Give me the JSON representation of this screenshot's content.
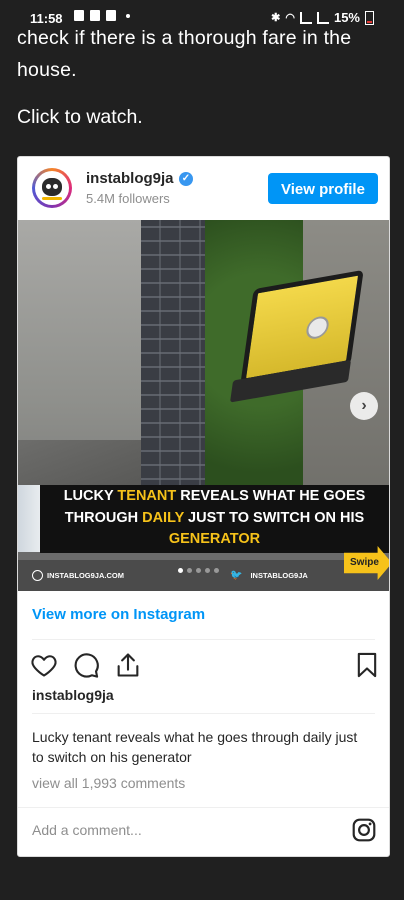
{
  "status_bar": {
    "time": "11:58",
    "battery": "15%"
  },
  "article": {
    "text": "check if there is a thorough fare in the house.",
    "click_to_watch": "Click to watch."
  },
  "embed": {
    "username": "instablog9ja",
    "verified_mark": "✓",
    "followers": "5.4M followers",
    "view_profile_label": "View profile",
    "media": {
      "caption_line1_a": "LUCKY ",
      "caption_line1_b": "TENANT",
      "caption_line1_c": " REVEALS WHAT HE GOES",
      "caption_line2_a": "THROUGH ",
      "caption_line2_b": "DAILY",
      "caption_line2_c": " JUST TO SWITCH ON HIS",
      "caption_line3": "GENERATOR",
      "footer_site": "INSTABLOG9JA.COM",
      "footer_handle": "INSTABLOG9JA",
      "swipe_label": "Swipe",
      "next_arrow": "›",
      "carousel_dots": 5,
      "carousel_active": 0
    },
    "view_more_label": "View more on Instagram",
    "owner": "instablog9ja",
    "post_caption": "Lucky tenant reveals what he goes through daily just to switch on his generator",
    "view_comments": "view all 1,993 comments",
    "add_comment_placeholder": "Add a comment...",
    "colors": {
      "accent": "#0095f6",
      "highlight": "#f6c21a",
      "background": "#202020"
    }
  }
}
